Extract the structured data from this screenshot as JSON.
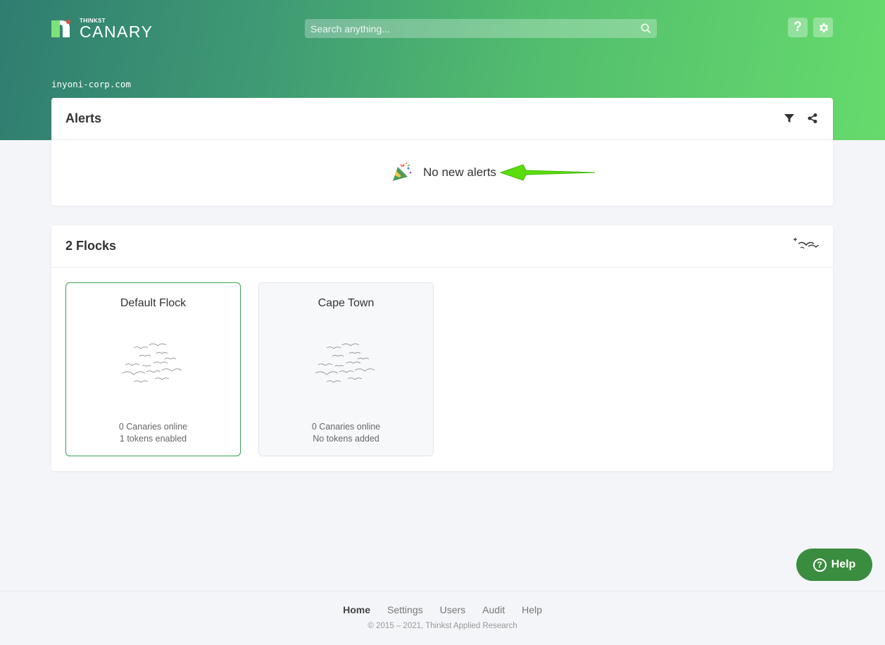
{
  "header": {
    "logo": {
      "small": "THINKST",
      "big": "CANARY",
      "icon": "canary-logo-icon"
    },
    "search_placeholder": "Search anything...",
    "help_label": "?",
    "settings_icon": "gear-icon",
    "domain": "inyoni-corp.com"
  },
  "alerts": {
    "title": "Alerts",
    "empty_text": "No new alerts",
    "icons": [
      "filter-icon",
      "share-icon",
      "party-popper-icon"
    ]
  },
  "flocks": {
    "title": "2 Flocks",
    "items": [
      {
        "name": "Default Flock",
        "canaries": "0 Canaries online",
        "tokens": "1 tokens enabled"
      },
      {
        "name": "Cape Town",
        "canaries": "0 Canaries online",
        "tokens": "No tokens added"
      }
    ]
  },
  "help_button": {
    "label": "Help"
  },
  "footer": {
    "nav": [
      "Home",
      "Settings",
      "Users",
      "Audit",
      "Help"
    ],
    "active": "Home",
    "copyright": "© 2015 – 2021, Thinkst Applied Research"
  },
  "colors": {
    "accent": "#3a8c3f",
    "hero_start": "#2f7d70",
    "hero_end": "#66db6c",
    "annotation_arrow": "#5ddc10"
  }
}
